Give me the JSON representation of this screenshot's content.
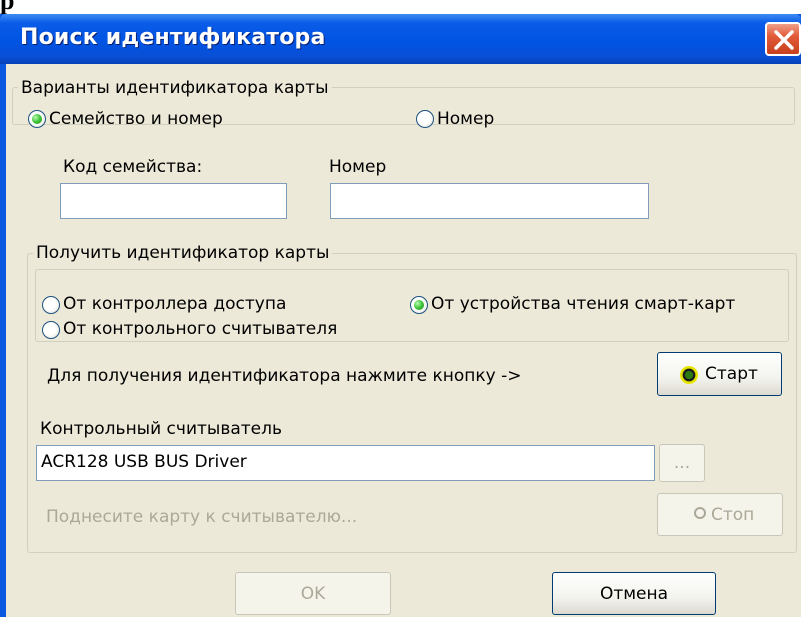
{
  "page_prefix": "р",
  "window": {
    "title": "Поиск идентификатора",
    "close_icon": "close-icon",
    "colors": {
      "titlebar": "#0054e3",
      "client": "#ece9d8",
      "close": "#e25b38"
    }
  },
  "group_variants": {
    "legend": "Варианты идентификатора карты",
    "radio_family": {
      "label": "Семейство и номер",
      "checked": true
    },
    "radio_number": {
      "label": "Номер",
      "checked": false
    },
    "family_code": {
      "label": "Код семейства:",
      "value": ""
    },
    "number": {
      "label": "Номер",
      "value": ""
    }
  },
  "group_get": {
    "legend": "Получить идентификатор карты",
    "radio_controller": {
      "label": "От контроллера доступа",
      "checked": false
    },
    "radio_control_reader": {
      "label": "От контрольного считывателя",
      "checked": false
    },
    "radio_smartcard": {
      "label": "От устройства чтения смарт-карт",
      "checked": true
    },
    "instruction": "Для получения идентификатора нажмите кнопку ->",
    "start_button": "Старт",
    "reader_label": "Контрольный считыватель",
    "reader_value": "ACR128 USB BUS Driver",
    "browse_button": "...",
    "hint": "Поднесите карту к считывателю...",
    "stop_button": "Стоп"
  },
  "footer": {
    "ok_button": "OK",
    "cancel_button": "Отмена"
  }
}
